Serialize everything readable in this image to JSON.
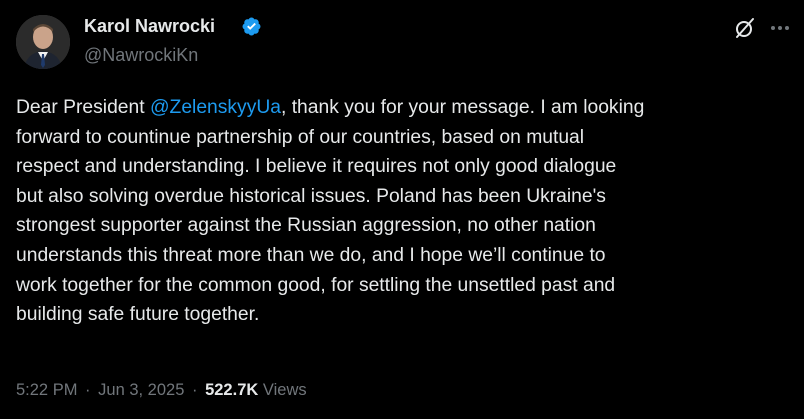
{
  "author": {
    "name": "Karol Nawrocki",
    "handle": "@NawrockiKn",
    "verified": true
  },
  "icons": {
    "verified": "verified-badge-icon",
    "grok": "grok-icon",
    "more": "more-options-icon"
  },
  "tweet": {
    "text_before_mention": "Dear President ",
    "mention": "@ZelenskyyUa",
    "text_after_mention": ", thank you for your message. I am looking\nforward to countinue partnership of our countries, based on mutual\nrespect and understanding. I believe it requires not only good dialogue\nbut also solving overdue historical issues. Poland has been Ukraine's\nstrongest supporter against the Russian aggression, no other nation\nunderstands this threat more than we do, and I hope we’ll continue to\nwork together for the common good, for settling the unsettled past and\nbuilding safe future together."
  },
  "meta": {
    "time": "5:22 PM",
    "separator": "·",
    "date": "Jun 3, 2025",
    "views_count": "522.7K",
    "views_label": "Views"
  },
  "colors": {
    "background": "#000000",
    "text": "#e7e9ea",
    "secondary": "#71767b",
    "accent": "#1d9bf0"
  }
}
